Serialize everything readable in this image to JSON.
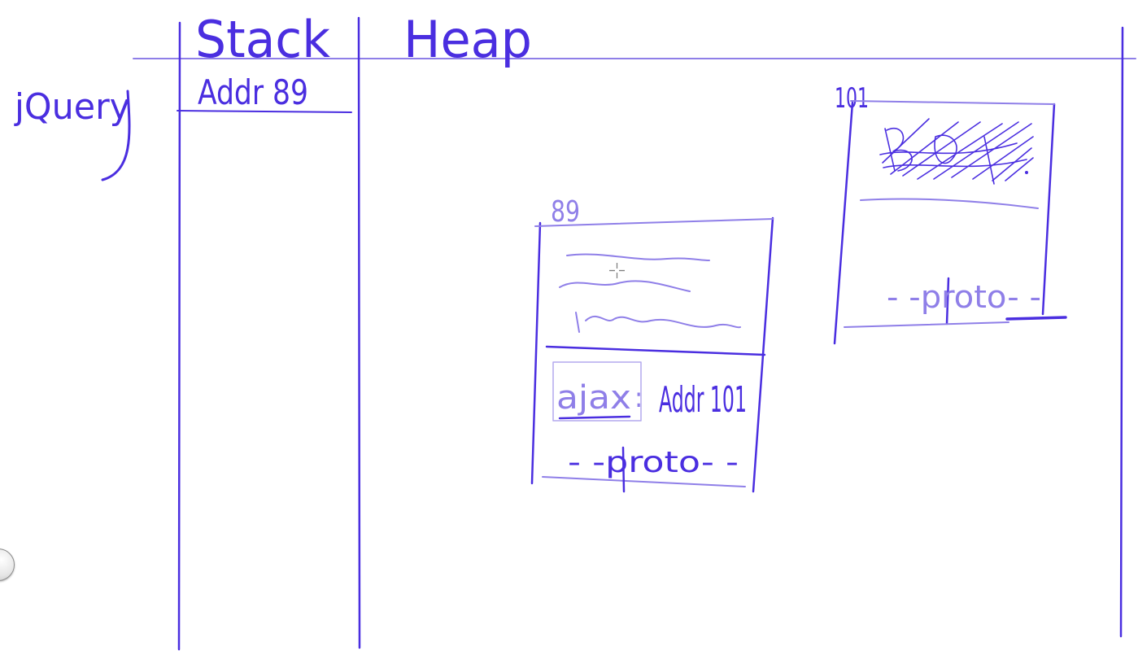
{
  "colors": {
    "ink": "#4a2ee0",
    "ink_light": "#8f7fe8",
    "ink_faint": "#b3a9ee"
  },
  "labels": {
    "stack": "Stack",
    "heap": "Heap",
    "jquery": "jQuery",
    "stack_value": "Addr 89",
    "object_89_address": "89",
    "object_101_address": "101",
    "ajax_key": "ajax",
    "ajax_value": "Addr 101",
    "proto_89": "- -proto- -",
    "proto_101": "- -proto- -"
  },
  "icons": {
    "side_knob": "circle-knob-icon",
    "cursor": "crosshair-cursor-icon"
  }
}
